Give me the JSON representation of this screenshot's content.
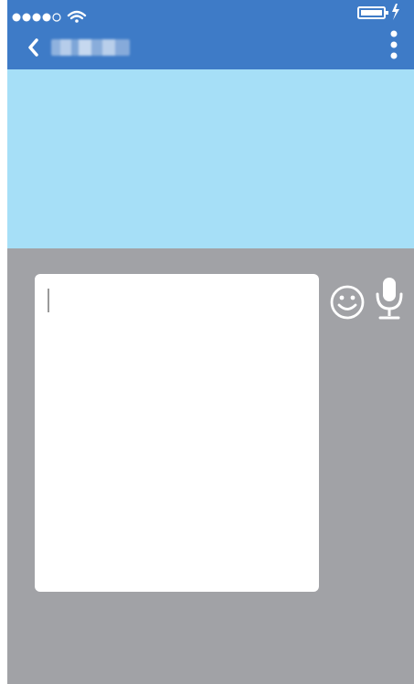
{
  "status_bar": {
    "signal_icon": "signal-dots-icon",
    "wifi_icon": "wifi-icon",
    "battery_icon": "battery-icon",
    "charging_icon": "lightning-icon",
    "signal_bars_filled": 4,
    "signal_bars_total": 5
  },
  "header": {
    "back_icon": "chevron-left-icon",
    "contact_name": "",
    "menu_icon": "more-vertical-icon",
    "background_color": "#3e7bc7"
  },
  "chat": {
    "background_color": "#a6dff7"
  },
  "composer": {
    "background_color": "#a1a2a6",
    "message_value": "",
    "emoji_icon": "smiley-icon",
    "mic_icon": "microphone-icon"
  }
}
